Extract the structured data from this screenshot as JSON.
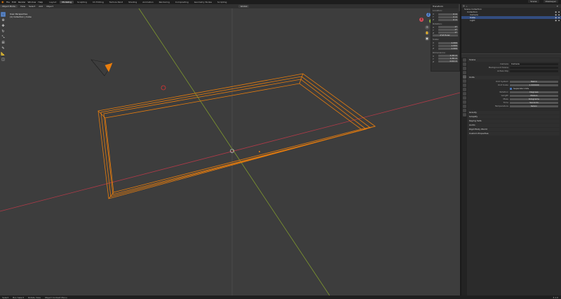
{
  "topbar": {
    "menu": [
      "File",
      "Edit",
      "Render",
      "Window",
      "Help"
    ],
    "tabs": [
      "Layout",
      "Modeling",
      "Sculpting",
      "UV Editing",
      "Texture Paint",
      "Shading",
      "Animation",
      "Rendering",
      "Compositing",
      "Geometry Nodes",
      "Scripting"
    ],
    "active_tab": "Modeling",
    "scene": "Scene",
    "view_layer": "ViewLayer"
  },
  "viewport_header": {
    "mode": "Object Mode",
    "menus": [
      "View",
      "Select",
      "Add",
      "Object"
    ],
    "orientation": "Global"
  },
  "viewport": {
    "view_name": "User Perspective",
    "collection_info": "(1) Collection | Cube"
  },
  "gizmo": {
    "x": "X",
    "y": "Y",
    "z": "Z"
  },
  "npanel": {
    "title": "Transform",
    "location_label": "Location:",
    "rotation_label": "Rotation:",
    "scale_label": "Scale:",
    "dimensions_label": "Dimensions:",
    "axis": [
      "X",
      "Y",
      "Z"
    ],
    "location": [
      "0 m",
      "0 m",
      "0 m"
    ],
    "rotation": [
      "0°",
      "0°",
      "0°"
    ],
    "rotation_mode": "XYZ Euler",
    "scale": [
      "1.000",
      "1.000",
      "1.000"
    ],
    "dimensions": [
      "2.26 m",
      "1.36 m",
      "0.04 m"
    ]
  },
  "outliner": {
    "search_placeholder": "",
    "items": [
      {
        "label": "Scene Collection",
        "selected": false
      },
      {
        "label": "Collection",
        "selected": false
      },
      {
        "label": "Camera",
        "selected": false
      },
      {
        "label": "Cube",
        "selected": true
      },
      {
        "label": "Light",
        "selected": false
      }
    ]
  },
  "properties": {
    "section_scene": "Scene",
    "camera_label": "Camera",
    "camera_value": "Camera",
    "background_scene_label": "Background Scene",
    "active_clip_label": "Active Clip",
    "units_section": "Units",
    "unit_system_label": "Unit System",
    "unit_system_value": "Metric",
    "unit_scale_label": "Unit Scale",
    "unit_scale_value": "1.000000",
    "separate_units_label": "Separate Units",
    "rotation_label": "Rotation",
    "rotation_value": "Degrees",
    "length_label": "Length",
    "length_value": "Meters",
    "mass_label": "Mass",
    "mass_value": "Kilograms",
    "time_label": "Time",
    "time_value": "Seconds",
    "temperature_label": "Temperature",
    "temperature_value": "Kelvin",
    "collapsed": [
      "Gravity",
      "Simplify",
      "Keying Sets",
      "Audio",
      "Rigid Body World",
      "Custom Properties"
    ]
  },
  "footer": {
    "items": [
      "Select",
      "Box Select",
      "Rotate View",
      "Object Context Menu"
    ],
    "version": "3.1.0"
  },
  "colors": {
    "accent": "#4772b3",
    "selection": "#e87d0d",
    "x_axis": "#b23a48",
    "y_axis": "#7f9a2e"
  }
}
